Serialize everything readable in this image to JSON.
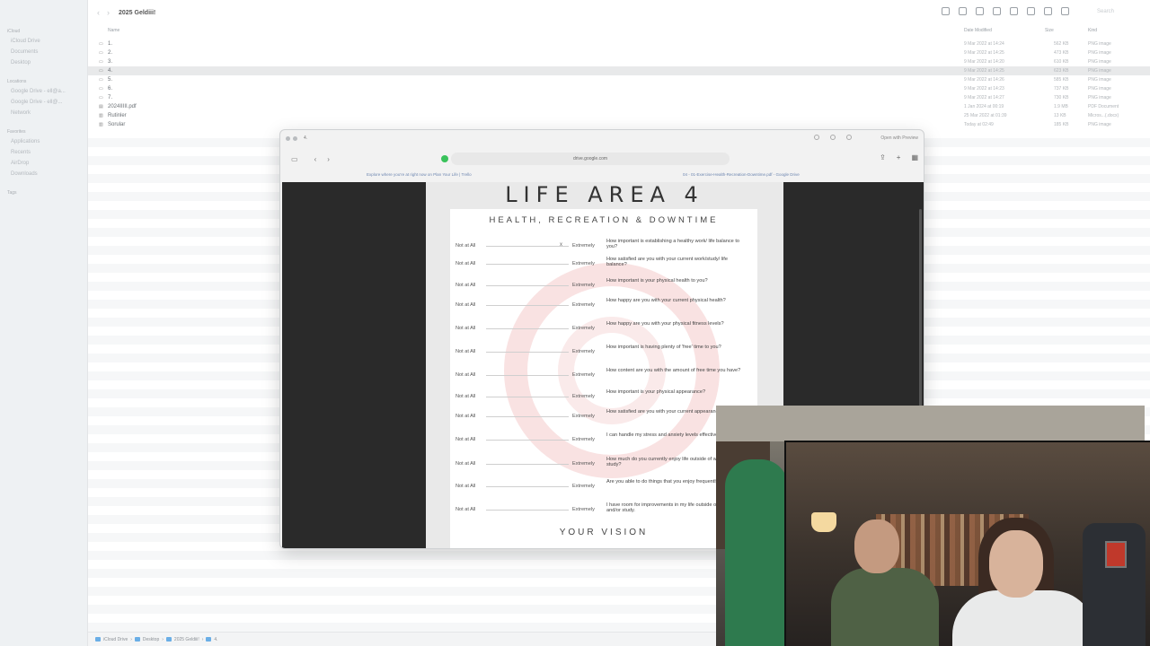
{
  "finder": {
    "window_title": "2025 Geldiii!",
    "search_placeholder": "Search",
    "columns": {
      "name": "Name",
      "date": "Date Modified",
      "size": "Size",
      "kind": "Kind"
    },
    "sidebar": {
      "sections": [
        {
          "title": "iCloud",
          "items": [
            "iCloud Drive",
            "Documents",
            "Desktop"
          ]
        },
        {
          "title": "Locations",
          "items": [
            "Google Drive - ell@a...",
            "Google Drive - ell@...",
            "Network"
          ]
        },
        {
          "title": "Favorites",
          "items": [
            "Applications",
            "Recents",
            "AirDrop",
            "Downloads"
          ]
        },
        {
          "title": "Tags",
          "items": []
        }
      ]
    },
    "files": [
      {
        "icon": "image",
        "name": "1.",
        "date": "9 Mar 2022 at 14:24",
        "size": "562 KB",
        "kind": "PNG image"
      },
      {
        "icon": "image",
        "name": "2.",
        "date": "9 Mar 2022 at 14:25",
        "size": "473 KB",
        "kind": "PNG image"
      },
      {
        "icon": "image",
        "name": "3.",
        "date": "9 Mar 2022 at 14:20",
        "size": "610 KB",
        "kind": "PNG image"
      },
      {
        "icon": "image",
        "name": "4.",
        "date": "9 Mar 2022 at 14:25",
        "size": "623 KB",
        "kind": "PNG image"
      },
      {
        "icon": "image",
        "name": "5.",
        "date": "9 Mar 2022 at 14:26",
        "size": "585 KB",
        "kind": "PNG image"
      },
      {
        "icon": "image",
        "name": "6.",
        "date": "9 Mar 2022 at 14:23",
        "size": "737 KB",
        "kind": "PNG image"
      },
      {
        "icon": "image",
        "name": "7.",
        "date": "9 Mar 2022 at 14:27",
        "size": "730 KB",
        "kind": "PNG image"
      },
      {
        "icon": "pdf",
        "name": "2024IIIII.pdf",
        "date": "1 Jan 2024 at 00:19",
        "size": "1.9 MB",
        "kind": "PDF Document"
      },
      {
        "icon": "doc",
        "name": "Rutinler",
        "date": "25 Mar 2022 at 01:39",
        "size": "13 KB",
        "kind": "Micros...(.docx)"
      },
      {
        "icon": "doc",
        "name": "Sorular",
        "date": "Today at 02:49",
        "size": "185 KB",
        "kind": "PNG image"
      }
    ],
    "selected_index": 3,
    "pathbar": [
      "iCloud Drive",
      "Desktop",
      "2025 Geldiii!",
      "4."
    ]
  },
  "preview": {
    "title": "4.",
    "open_with": "Open with Preview",
    "url": "drive.google.com",
    "tabs": [
      "Explore where you're at right now on Plan Your Life | Trello",
      "04 - 01-Exercise-Health-Recreation-Downtime.pdf - Google Drive"
    ],
    "pdf": {
      "title": "LIFE AREA 4",
      "subtitle": "HEALTH, RECREATION & DOWNTIME",
      "low_label": "Not at All",
      "high_label": "Extremely",
      "questions": [
        {
          "text": "How important is establishing a healthy work/ life balance to you?",
          "mark": "x"
        },
        {
          "text": "How satisfied are you with your current work/study/ life balance?",
          "mark": ""
        },
        {
          "text": "How important is your physical health to you?",
          "mark": ""
        },
        {
          "text": "How happy are you with your current physical health?",
          "mark": ""
        },
        {
          "text": "How happy are you with your physical fitness levels?",
          "mark": ""
        },
        {
          "text": "How important is having plenty of 'free' time to you?",
          "mark": ""
        },
        {
          "text": "How content are you with the amount of free time you have?",
          "mark": ""
        },
        {
          "text": "How important is your physical appearance?",
          "mark": ""
        },
        {
          "text": "How satisfied are you with your current appearance?",
          "mark": ""
        },
        {
          "text": "I can handle my stress and anxiety levels effectively.",
          "mark": ""
        },
        {
          "text": "How much do you currently enjoy life outside of work or study?",
          "mark": ""
        },
        {
          "text": "Are you able to do things that you enjoy frequently?",
          "mark": ""
        },
        {
          "text": "I have room for improvements in my life outside of work and/or study.",
          "mark": ""
        }
      ],
      "footer": "YOUR VISION"
    }
  }
}
